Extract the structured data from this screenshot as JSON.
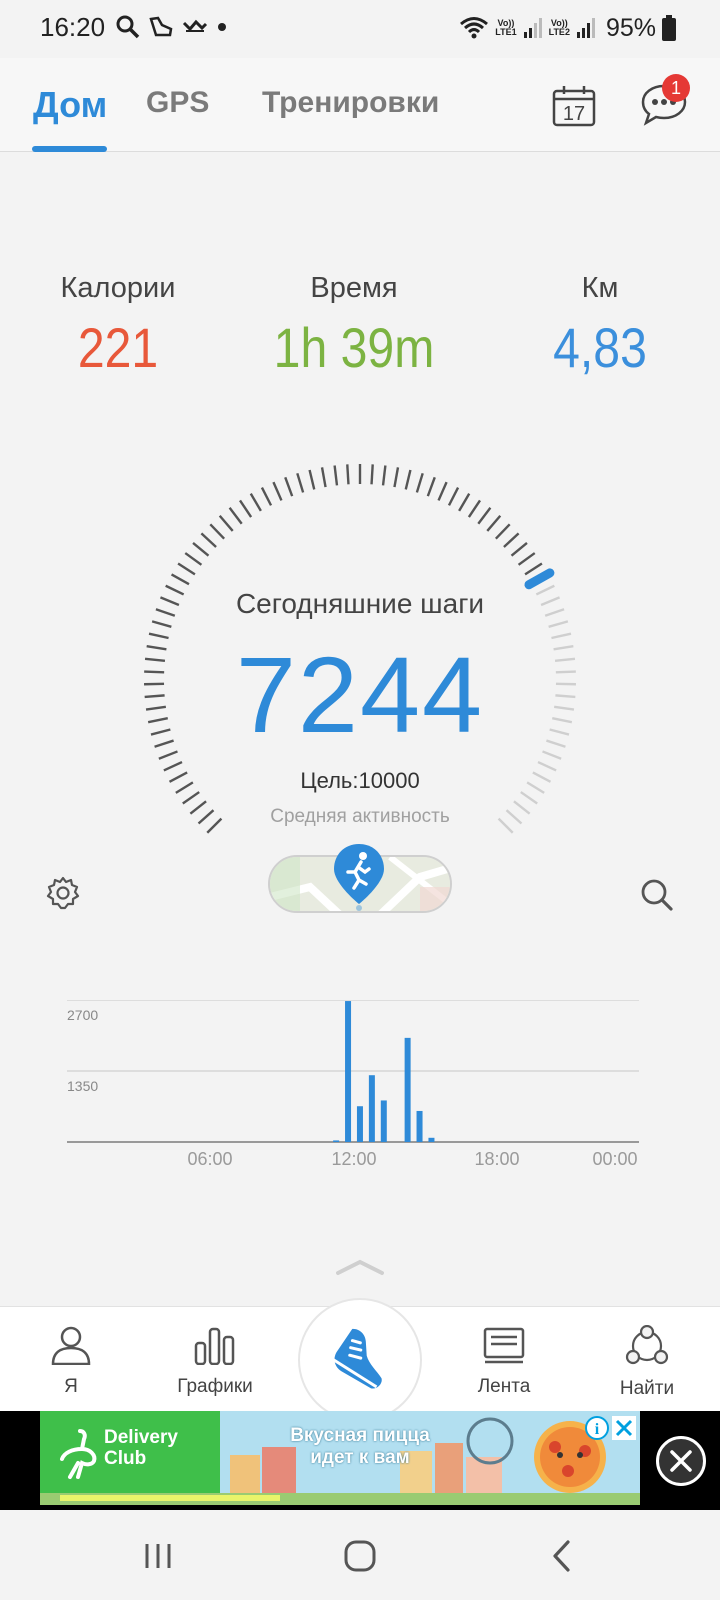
{
  "status_bar": {
    "time": "16:20",
    "battery": "95%",
    "sim1": "Vo))\nLTE1",
    "sim2": "Vo))\nLTE2"
  },
  "tabs": {
    "home": "Дом",
    "gps": "GPS",
    "workouts": "Тренировки",
    "calendar_day": "17",
    "chat_badge": "1"
  },
  "stats": {
    "calories_label": "Калории",
    "calories_value": "221",
    "time_label": "Время",
    "time_value": "1h 39m",
    "km_label": "Км",
    "km_value": "4,83"
  },
  "gauge": {
    "title": "Сегодняшние шаги",
    "steps": "7244",
    "goal": "Цель:10000",
    "activity": "Средняя активность",
    "progress": 0.7244
  },
  "chart_data": {
    "type": "bar",
    "y_ticks": [
      "2700",
      "1350"
    ],
    "x_ticks": [
      "06:00",
      "12:00",
      "18:00",
      "00:00"
    ],
    "ylim": [
      0,
      2700
    ],
    "bars": [
      {
        "hour": 11.25,
        "value": 30
      },
      {
        "hour": 11.75,
        "value": 2680
      },
      {
        "hour": 12.25,
        "value": 680
      },
      {
        "hour": 12.75,
        "value": 1270
      },
      {
        "hour": 13.25,
        "value": 790
      },
      {
        "hour": 14.25,
        "value": 1980
      },
      {
        "hour": 14.75,
        "value": 590
      },
      {
        "hour": 15.25,
        "value": 80
      }
    ]
  },
  "bottom_nav": {
    "me": "Я",
    "charts": "Графики",
    "feed": "Лента",
    "find": "Найти"
  },
  "ad": {
    "brand": "Delivery\nClub",
    "text": "Вкусная пицца\nидет к вам"
  },
  "colors": {
    "accent": "#2e8ad8",
    "calories": "#e8583a",
    "time": "#7cb342",
    "km": "#3b8fdc"
  }
}
